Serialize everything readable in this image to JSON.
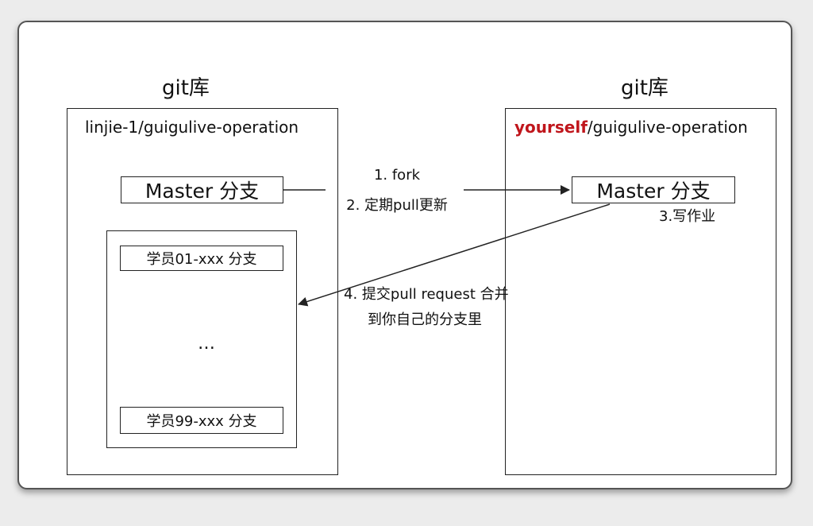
{
  "left_repo": {
    "title": "git库",
    "name": "linjie-1/guigulive-operation",
    "master_branch": "Master 分支",
    "student_first": "学员01-xxx 分支",
    "ellipsis": "…",
    "student_last": "学员99-xxx 分支"
  },
  "right_repo": {
    "title": "git库",
    "owner": "yourself",
    "name_rest": "/guigulive-operation",
    "master_branch": "Master 分支"
  },
  "steps": {
    "step1": "1. fork",
    "step2": "2. 定期pull更新",
    "step3": "3.写作业",
    "step4_line1": "4. 提交pull request 合并",
    "step4_line2": "到你自己的分支里"
  },
  "colors": {
    "owner_accent": "#c0161c",
    "line": "#222222"
  }
}
